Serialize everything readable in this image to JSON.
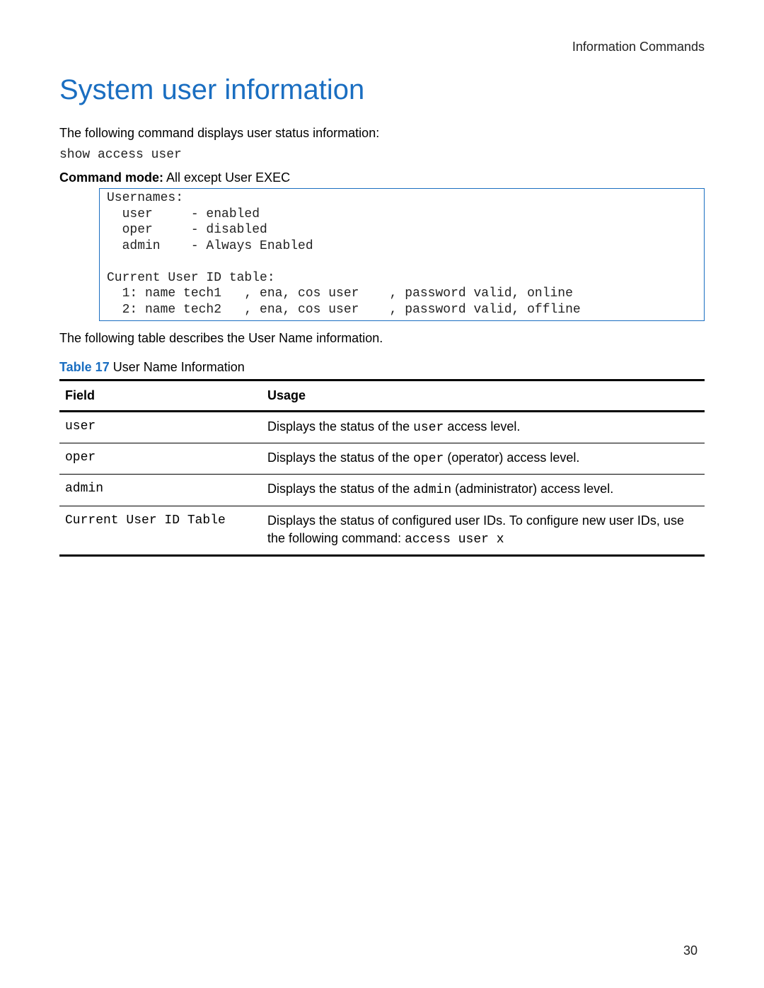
{
  "header": {
    "section_label": "Information Commands"
  },
  "title": "System user information",
  "intro_text": "The following command displays user status information:",
  "command": "show access user",
  "mode": {
    "label": "Command mode:",
    "value": " All except User EXEC"
  },
  "code_block": "Usernames:\n  user     - enabled\n  oper     - disabled\n  admin    - Always Enabled\n\nCurrent User ID table:\n  1: name tech1   , ena, cos user    , password valid, online\n  2: name tech2   , ena, cos user    , password valid, offline",
  "table_intro": "The following table describes the User Name information.",
  "table_caption": {
    "label": "Table 17",
    "title": "  User Name Information"
  },
  "table": {
    "headers": {
      "field": "Field",
      "usage": "Usage"
    },
    "rows": [
      {
        "field": "user",
        "usage_pre": "Displays the status of the ",
        "usage_mono": "user",
        "usage_post": " access level."
      },
      {
        "field": "oper",
        "usage_pre": "Displays the status of the ",
        "usage_mono": "oper",
        "usage_post": " (operator) access level."
      },
      {
        "field": "admin",
        "usage_pre": "Displays the status of the ",
        "usage_mono": "admin",
        "usage_post": " (administrator) access level."
      },
      {
        "field": "Current User ID Table",
        "usage_pre": "Displays the status of configured user IDs. To configure new user IDs, use the following command: ",
        "usage_mono": "access user x",
        "usage_post": ""
      }
    ]
  },
  "page_number": "30"
}
